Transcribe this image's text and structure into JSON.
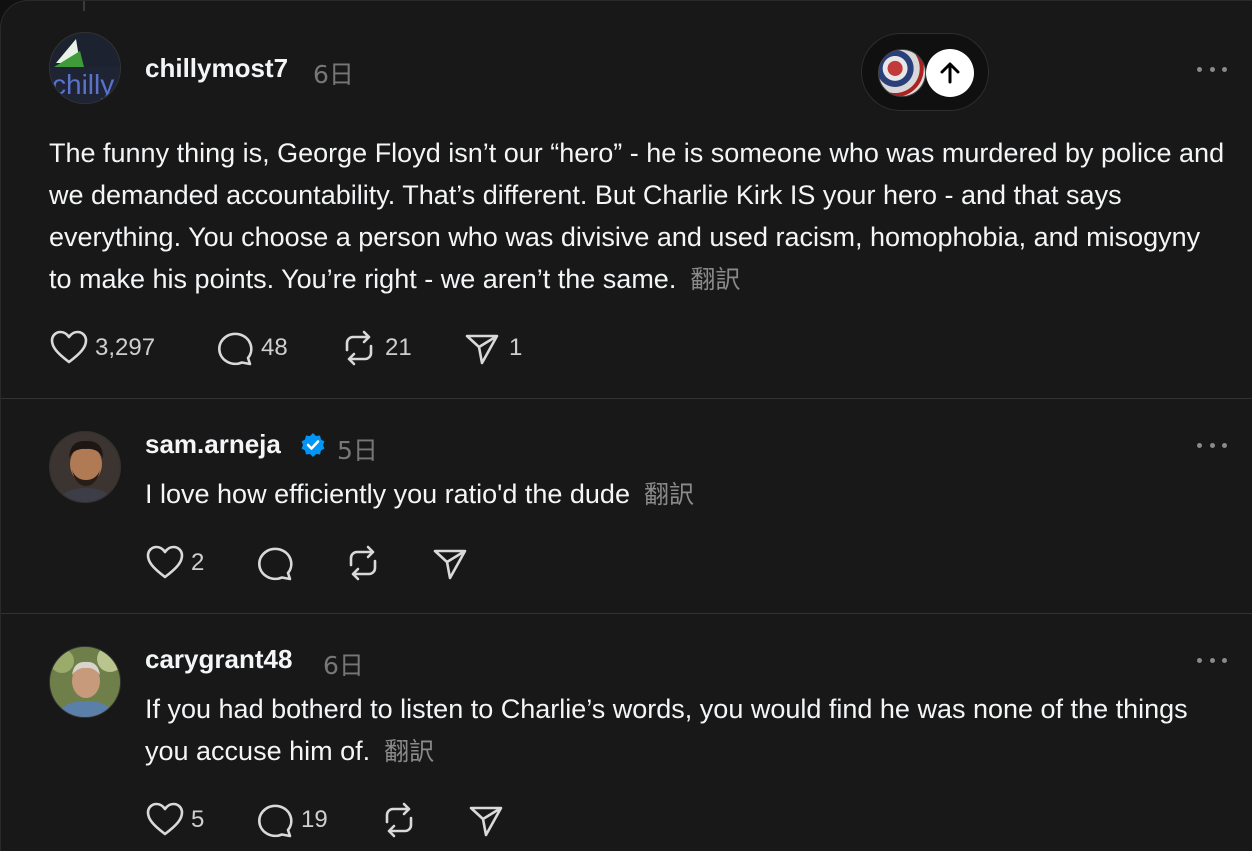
{
  "posts": [
    {
      "username": "chillymost7",
      "time": "6日",
      "avatar_text": "chilly",
      "text": "The funny thing is, George Floyd isn’t our “hero” - he is someone who was murdered by police and we demanded accountability. That’s different. But Charlie Kirk IS your hero - and that says everything. You choose a person who was divisive and used racism, homophobia, and misogyny to make his points. You’re right - we aren’t the same.",
      "translate": "翻訳",
      "likes": "3,297",
      "replies": "48",
      "reposts": "21",
      "shares": "1"
    },
    {
      "username": "sam.arneja",
      "verified": true,
      "time": "5日",
      "text": "I love how efficiently you ratio'd the dude",
      "translate": "翻訳",
      "likes": "2",
      "replies": "",
      "reposts": "",
      "shares": ""
    },
    {
      "username": "carygrant48",
      "time": "6日",
      "text": "If you had botherd to listen to Charlie’s words, you would find he was none of the things you accuse him of.",
      "translate": "翻訳",
      "likes": "5",
      "replies": "19",
      "reposts": "",
      "shares": ""
    }
  ],
  "icons": {
    "like": "heart-icon",
    "reply": "comment-icon",
    "repost": "repost-icon",
    "share": "send-icon",
    "more": "more-icon",
    "verified": "verified-badge-icon",
    "scroll_up": "arrow-up-icon"
  },
  "colors": {
    "background": "#181818",
    "text": "#f3f5f7",
    "muted": "#777777",
    "verified": "#0095f6"
  }
}
